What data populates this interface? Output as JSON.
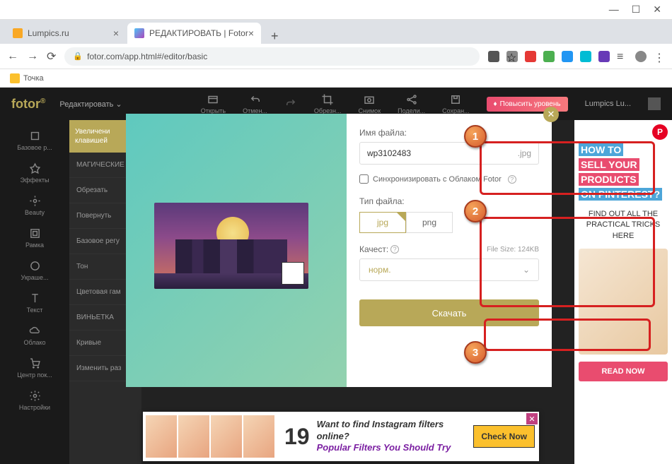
{
  "window": {
    "tab1": "Lumpics.ru",
    "tab2": "РЕДАКТИРОВАТЬ | Fotor",
    "url": "fotor.com/app.html#/editor/basic",
    "bookmark": "Точка"
  },
  "app": {
    "logo": "fotor",
    "editMenu": "Редактировать",
    "user": "Lumpics Lu..."
  },
  "topActions": {
    "open": "Открыть",
    "undo": "Отмен...",
    "redo": "",
    "crop": "Обрезн...",
    "snap": "Снимок",
    "share": "Подели...",
    "save": "Сохран..."
  },
  "promo": "Повысить уровень",
  "rail": {
    "i0": "Базовое р...",
    "i1": "Эффекты",
    "i2": "Beauty",
    "i3": "Рамка",
    "i4": "Украше...",
    "i5": "Текст",
    "i6": "Облако",
    "i7": "Центр пок...",
    "i8": "Настройки"
  },
  "sub": {
    "tip": "Увеличени\nклавишей",
    "i0": "МАГИЧЕСКИЕ",
    "i1": "Обрезать",
    "i2": "Повернуть",
    "i3": "Базовое регу",
    "i4": "Тон",
    "i5": "Цветовая гам",
    "i6": "ВИНЬЕТКА",
    "i7": "Кривые",
    "i8": "Изменить раз"
  },
  "modal": {
    "filenameLabel": "Имя файла:",
    "filename": "wp3102483",
    "ext": ".jpg",
    "sync": "Синхронизировать с Облаком Fotor",
    "typeLabel": "Тип файла:",
    "fmt_jpg": "jpg",
    "fmt_png": "png",
    "qualityLabel": "Качест:",
    "filesize": "File Size: 124KB",
    "quality": "норм.",
    "download": "Скачать"
  },
  "ad": {
    "t1": "HOW TO",
    "t2": "SELL YOUR",
    "t3": "PRODUCTS",
    "t4": "ON PINTEREST?",
    "sub": "FIND OUT ALL THE PRACTICAL TRICKS HERE",
    "cta": "READ NOW"
  },
  "banner": {
    "num": "19",
    "line1": "Want to find Instagram filters online?",
    "line2": "Popular Filters You Should Try",
    "cta": "Check Now"
  },
  "markers": {
    "m1": "1",
    "m2": "2",
    "m3": "3"
  }
}
